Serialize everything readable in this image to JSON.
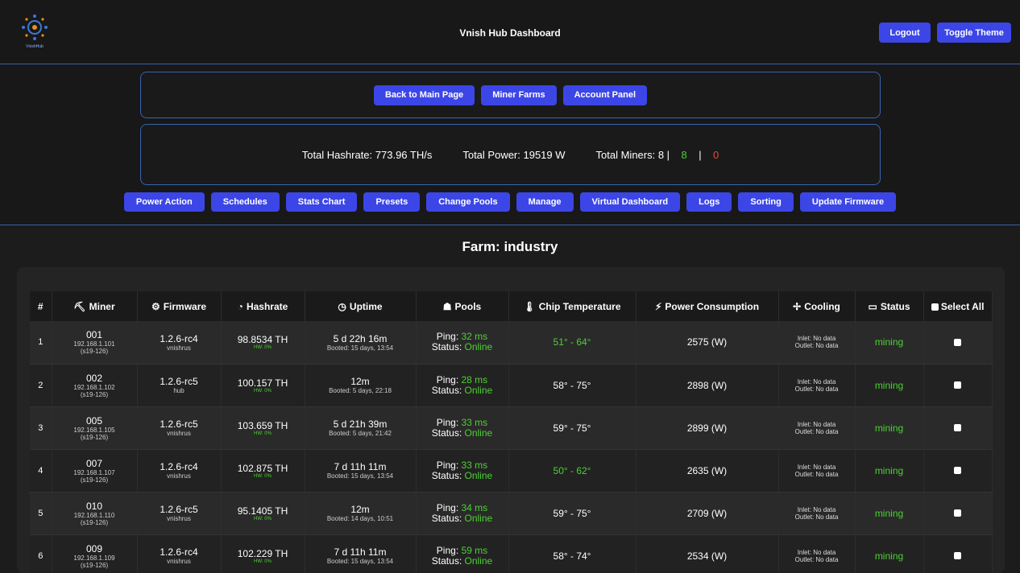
{
  "header": {
    "title": "Vnish Hub Dashboard",
    "logo_text": "VnishHub",
    "logout": "Logout",
    "toggle_theme": "Toggle Theme"
  },
  "nav": [
    "Back to Main Page",
    "Miner Farms",
    "Account Panel"
  ],
  "stats": {
    "hashrate": "Total Hashrate: 773.96 TH/s",
    "power": "Total Power: 19519 W",
    "miners_label": "Total Miners: 8 |",
    "online": "8",
    "sep": "|",
    "offline": "0"
  },
  "actions": [
    "Power Action",
    "Schedules",
    "Stats Chart",
    "Presets",
    "Change Pools",
    "Manage",
    "Virtual Dashboard",
    "Logs",
    "Sorting",
    "Update Firmware"
  ],
  "farm_title": "Farm: industry",
  "columns": {
    "num": "#",
    "miner": "Miner",
    "firmware": "Firmware",
    "hashrate": "Hashrate",
    "uptime": "Uptime",
    "pools": "Pools",
    "chip_temp": "Chip Temperature",
    "power": "Power Consumption",
    "cooling": "Cooling",
    "status": "Status",
    "select_all": "Select All"
  },
  "icons": {
    "miner": "miner-icon",
    "firmware": "chip-icon",
    "hashrate": "gauge-icon",
    "uptime": "clock-icon",
    "pools": "pools-icon",
    "chip_temp": "thermometer-icon",
    "power": "bolt-icon",
    "cooling": "fan-icon",
    "status": "monitor-icon"
  },
  "colors": {
    "accent": "#3c46e6",
    "ok": "#4cd132",
    "bad": "#e84a3a",
    "border": "#3a63b0"
  },
  "rows": [
    {
      "num": "1",
      "id": "001",
      "ip": "192.168.1.101",
      "model": "(s19-126)",
      "fw": "1.2.6-rc4",
      "fw_sub": "vnishrus",
      "hash": "98.8534 TH",
      "hw": "HW: 0%",
      "uptime": "5 d 22h 16m",
      "booted": "Booted: 15 days, 13:54",
      "ping_label": "Ping:",
      "ping": "32 ms",
      "status_label": "Status:",
      "pool_status": "Online",
      "temp": "51° - 64°",
      "temp_green": true,
      "power": "2575 (W)",
      "inlet": "Inlet: No data",
      "outlet": "Outlet: No data",
      "status": "mining"
    },
    {
      "num": "2",
      "id": "002",
      "ip": "192.168.1.102",
      "model": "(s19-126)",
      "fw": "1.2.6-rc5",
      "fw_sub": "hub",
      "hash": "100.157 TH",
      "hw": "HW: 0%",
      "uptime": "12m",
      "booted": "Booted: 5 days, 22:18",
      "ping_label": "Ping:",
      "ping": "28 ms",
      "status_label": "Status:",
      "pool_status": "Online",
      "temp": "58° - 75°",
      "temp_green": false,
      "power": "2898 (W)",
      "inlet": "Inlet: No data",
      "outlet": "Outlet: No data",
      "status": "mining"
    },
    {
      "num": "3",
      "id": "005",
      "ip": "192.168.1.105",
      "model": "(s19-126)",
      "fw": "1.2.6-rc5",
      "fw_sub": "vnishrus",
      "hash": "103.659 TH",
      "hw": "HW: 0%",
      "uptime": "5 d 21h 39m",
      "booted": "Booted: 5 days, 21:42",
      "ping_label": "Ping:",
      "ping": "33 ms",
      "status_label": "Status:",
      "pool_status": "Online",
      "temp": "59° - 75°",
      "temp_green": false,
      "power": "2899 (W)",
      "inlet": "Inlet: No data",
      "outlet": "Outlet: No data",
      "status": "mining"
    },
    {
      "num": "4",
      "id": "007",
      "ip": "192.168.1.107",
      "model": "(s19-126)",
      "fw": "1.2.6-rc4",
      "fw_sub": "vnishrus",
      "hash": "102.875 TH",
      "hw": "HW: 0%",
      "uptime": "7 d 11h 11m",
      "booted": "Booted: 15 days, 13:54",
      "ping_label": "Ping:",
      "ping": "33 ms",
      "status_label": "Status:",
      "pool_status": "Online",
      "temp": "50° - 62°",
      "temp_green": true,
      "power": "2635 (W)",
      "inlet": "Inlet: No data",
      "outlet": "Outlet: No data",
      "status": "mining"
    },
    {
      "num": "5",
      "id": "010",
      "ip": "192.168.1.110",
      "model": "(s19-126)",
      "fw": "1.2.6-rc5",
      "fw_sub": "vnishrus",
      "hash": "95.1405 TH",
      "hw": "HW: 0%",
      "uptime": "12m",
      "booted": "Booted: 14 days, 10:51",
      "ping_label": "Ping:",
      "ping": "34 ms",
      "status_label": "Status:",
      "pool_status": "Online",
      "temp": "59° - 75°",
      "temp_green": false,
      "power": "2709 (W)",
      "inlet": "Inlet: No data",
      "outlet": "Outlet: No data",
      "status": "mining"
    },
    {
      "num": "6",
      "id": "009",
      "ip": "192.168.1.109",
      "model": "(s19-126)",
      "fw": "1.2.6-rc4",
      "fw_sub": "vnishrus",
      "hash": "102.229 TH",
      "hw": "HW: 0%",
      "uptime": "7 d 11h 11m",
      "booted": "Booted: 15 days, 13:54",
      "ping_label": "Ping:",
      "ping": "59 ms",
      "status_label": "Status:",
      "pool_status": "Online",
      "temp": "58° - 74°",
      "temp_green": false,
      "power": "2534 (W)",
      "inlet": "Inlet: No data",
      "outlet": "Outlet: No data",
      "status": "mining"
    }
  ]
}
